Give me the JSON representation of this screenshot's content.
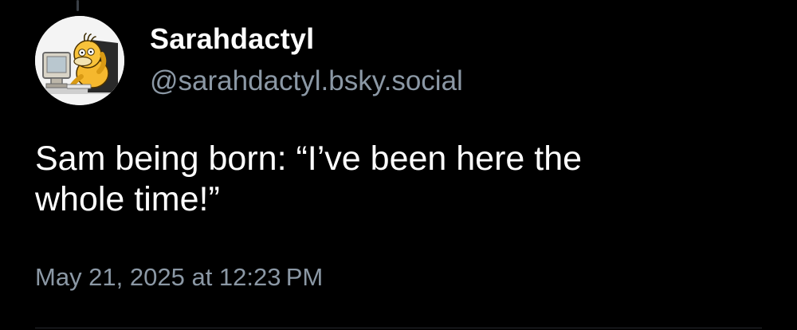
{
  "post": {
    "author": {
      "display_name": "Sarahdactyl",
      "handle": "@sarahdactyl.bsky.social",
      "avatar_icon": "psyduck-at-computer-avatar"
    },
    "text_lines": [
      "Sam being born: “I’ve been here the",
      "whole time!”"
    ],
    "timestamp": "May 21, 2025 at 12:23 PM"
  },
  "colors": {
    "background": "#000000",
    "primary_text": "#ffffff",
    "secondary_text": "#8b98a5",
    "divider": "#26292e"
  }
}
